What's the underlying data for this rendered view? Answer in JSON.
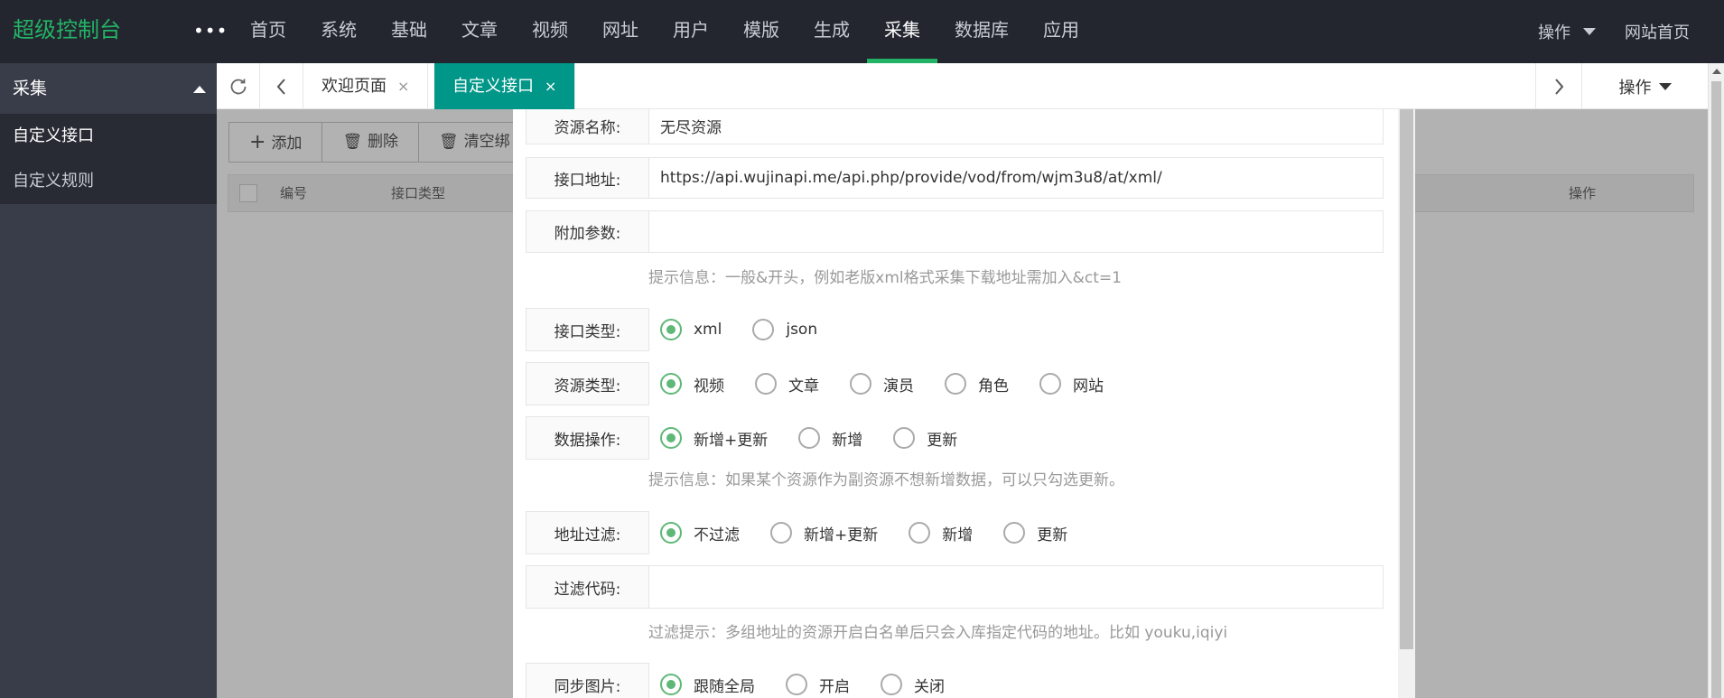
{
  "header": {
    "logo": "超级控制台",
    "more_icon": "ellipsis-icon",
    "nav": [
      "首页",
      "系统",
      "基础",
      "文章",
      "视频",
      "网址",
      "用户",
      "模版",
      "生成",
      "采集",
      "数据库",
      "应用"
    ],
    "active_nav": "采集",
    "right": {
      "ops": "操作",
      "home": "网站首页"
    }
  },
  "sidebar": {
    "title": "采集",
    "items": [
      {
        "label": "自定义接口"
      },
      {
        "label": "自定义规则"
      }
    ]
  },
  "tabs": {
    "items": [
      {
        "label": "欢迎页面"
      },
      {
        "label": "自定义接口"
      }
    ],
    "close_glyph": "×",
    "ops": "操作"
  },
  "list": {
    "buttons": {
      "add": "添加",
      "delete": "删除",
      "clear": "清空绑"
    },
    "columns": {
      "id": "编号",
      "type": "接口类型",
      "ops": "操作"
    }
  },
  "form": {
    "name": {
      "label": "资源名称:",
      "value": "无尽资源"
    },
    "url": {
      "label": "接口地址:",
      "value": "https://api.wujinapi.me/api.php/provide/vod/from/wjm3u8/at/xml/"
    },
    "params": {
      "label": "附加参数:",
      "value": "",
      "hint": "提示信息：一般&开头，例如老版xml格式采集下载地址需加入&ct=1"
    },
    "api_type": {
      "label": "接口类型:",
      "options": [
        "xml",
        "json"
      ],
      "selected": "xml"
    },
    "res_type": {
      "label": "资源类型:",
      "options": [
        "视频",
        "文章",
        "演员",
        "角色",
        "网站"
      ],
      "selected": "视频"
    },
    "data_op": {
      "label": "数据操作:",
      "options": [
        "新增+更新",
        "新增",
        "更新"
      ],
      "selected": "新增+更新",
      "hint": "提示信息：如果某个资源作为副资源不想新增数据，可以只勾选更新。"
    },
    "url_filter": {
      "label": "地址过滤:",
      "options": [
        "不过滤",
        "新增+更新",
        "新增",
        "更新"
      ],
      "selected": "不过滤"
    },
    "filter_code": {
      "label": "过滤代码:",
      "value": "",
      "hint": "过滤提示：多组地址的资源开启白名单后只会入库指定代码的地址。比如 youku,iqiyi"
    },
    "sync_pic": {
      "label": "同步图片:",
      "options": [
        "跟随全局",
        "开启",
        "关闭"
      ],
      "selected": "跟随全局"
    }
  },
  "colors": {
    "accent": "#23b366",
    "tab_active": "#009688",
    "radio": "#5fb878",
    "header_bg": "#23262e",
    "sidebar_bg": "#393d49"
  }
}
